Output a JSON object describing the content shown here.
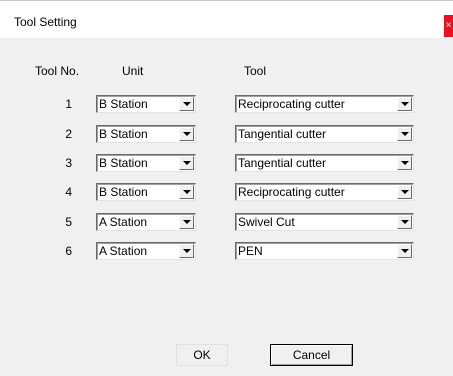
{
  "window": {
    "title": "Tool Setting",
    "close_glyph": "×"
  },
  "headers": {
    "tool_no": "Tool No.",
    "unit": "Unit",
    "tool": "Tool"
  },
  "rows": [
    {
      "number": "1",
      "unit": "B Station",
      "tool": "Reciprocating cutter"
    },
    {
      "number": "2",
      "unit": "B Station",
      "tool": "Tangential cutter"
    },
    {
      "number": "3",
      "unit": "B Station",
      "tool": "Tangential cutter"
    },
    {
      "number": "4",
      "unit": "B Station",
      "tool": "Reciprocating cutter"
    },
    {
      "number": "5",
      "unit": "A Station",
      "tool": "Swivel Cut"
    },
    {
      "number": "6",
      "unit": "A Station",
      "tool": "PEN"
    }
  ],
  "buttons": {
    "ok": "OK",
    "cancel": "Cancel"
  },
  "colors": {
    "close_button": "#e81123",
    "dialog_background": "#f0f0f0"
  }
}
